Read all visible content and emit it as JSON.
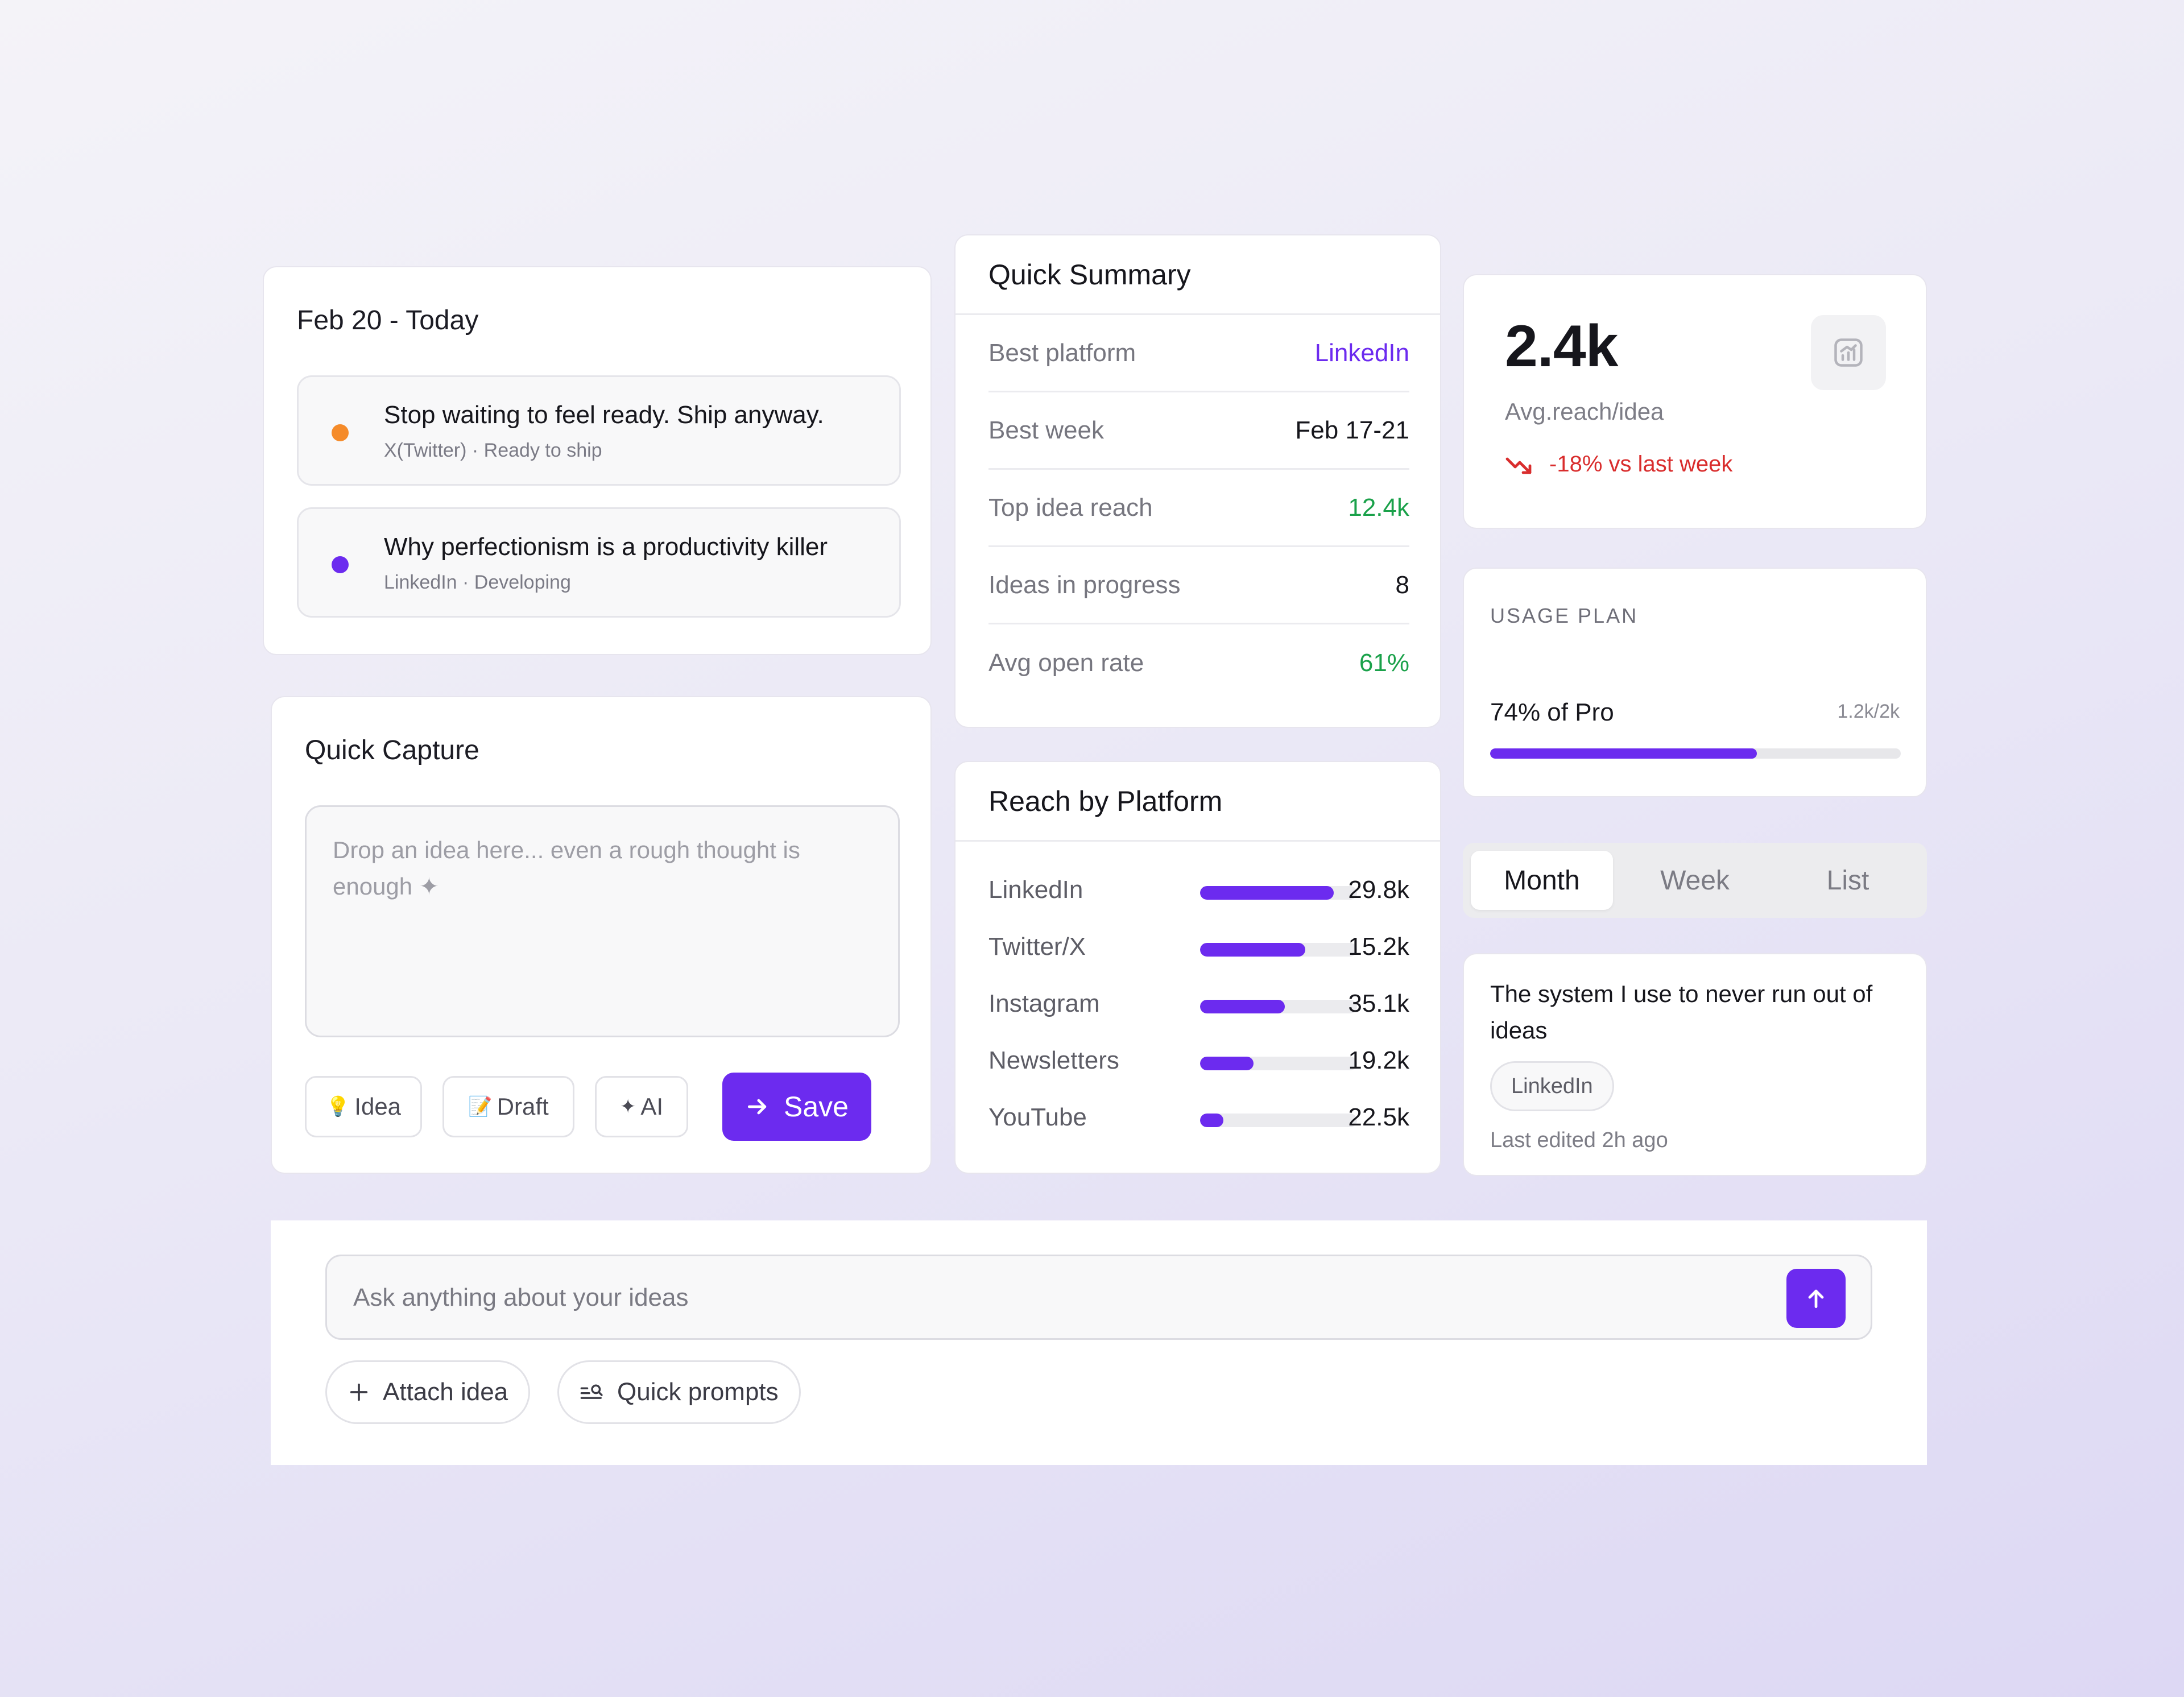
{
  "today": {
    "title": "Feb 20 - Today",
    "tasks": [
      {
        "title": "Stop waiting to feel ready. Ship anyway.",
        "meta": "X(Twitter) · Ready to ship",
        "dot_color": "#f58b2a"
      },
      {
        "title": "Why perfectionism is a productivity killer",
        "meta": "LinkedIn · Developing",
        "dot_color": "#6c2bef"
      }
    ]
  },
  "capture": {
    "title": "Quick Capture",
    "placeholder": "Drop an idea here... even a rough thought is enough ✦",
    "chips": [
      {
        "icon": "💡",
        "label": "Idea"
      },
      {
        "icon": "📝",
        "label": "Draft"
      },
      {
        "icon": "✦",
        "label": "AI"
      }
    ],
    "save_label": "Save"
  },
  "summary": {
    "title": "Quick Summary",
    "rows": [
      {
        "label": "Best platform",
        "value": "LinkedIn",
        "color": "#6c2bef"
      },
      {
        "label": "Best week",
        "value": "Feb 17-21",
        "color": "#16161c"
      },
      {
        "label": "Top idea reach",
        "value": "12.4k",
        "color": "#1aa14a"
      },
      {
        "label": "Ideas in progress",
        "value": "8",
        "color": "#16161c"
      },
      {
        "label": "Avg open rate",
        "value": "61%",
        "color": "#1aa14a"
      }
    ]
  },
  "reach": {
    "title": "Reach by Platform",
    "rows": [
      {
        "label": "LinkedIn",
        "value": "29.8k",
        "fill": 0.85
      },
      {
        "label": "Twitter/X",
        "value": "15.2k",
        "fill": 0.67
      },
      {
        "label": "Instagram",
        "value": "35.1k",
        "fill": 0.54
      },
      {
        "label": "Newsletters",
        "value": "19.2k",
        "fill": 0.34
      },
      {
        "label": "YouTube",
        "value": "22.5k",
        "fill": 0.15
      }
    ]
  },
  "kpi": {
    "value": "2.4k",
    "label": "Avg.reach/idea",
    "trend": "-18% vs last week",
    "trend_color": "#d92d2d"
  },
  "usage": {
    "title": "USAGE PLAN",
    "percent_label": "74% of Pro",
    "ratio": "1.2k/2k",
    "fill": 0.65
  },
  "view_toggle": {
    "options": [
      "Month",
      "Week",
      "List"
    ],
    "selected": "Month"
  },
  "idea_card": {
    "title": "The system I use to never run out of ideas",
    "tag": "LinkedIn",
    "edited": "Last edited 2h ago"
  },
  "chat": {
    "placeholder": "Ask anything about your ideas",
    "attach_label": "Attach idea",
    "prompts_label": "Quick prompts"
  },
  "colors": {
    "accent": "#6c2bef",
    "positive": "#1aa14a",
    "negative": "#d92d2d",
    "warning_dot": "#f58b2a"
  }
}
